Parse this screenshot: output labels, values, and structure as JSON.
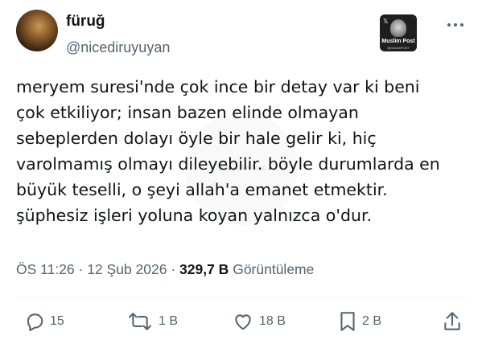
{
  "author": {
    "display_name": "füruğ",
    "handle": "@nicediruyuyan"
  },
  "watermark_badge": {
    "title": "Muslim Post",
    "subtitle": "@MuslimPOST",
    "x_glyph": "𝕏"
  },
  "tweet": {
    "lines": [
      "meryem suresi'nde çok ince bir detay var ki beni",
      "çok etkiliyor; insan bazen elinde olmayan",
      "sebeplerden dolayı öyle bir hale gelir ki, hiç",
      "varolmamış olmayı dileyebilir. böyle durumlarda en",
      "büyük teselli, o şeyi allah'a emanet etmektir.",
      "şüphesiz işleri yoluna koyan yalnızca o'dur."
    ]
  },
  "center_watermark": "@MuslimPost",
  "meta": {
    "time": "ÖS 11:26",
    "separator": " · ",
    "date": "12 Şub 2026",
    "views_count": "329,7 B",
    "views_label": "Görüntüleme"
  },
  "actions": {
    "reply_count": "15",
    "retweet_count": "1 B",
    "like_count": "18 B",
    "bookmark_count": "2 B"
  },
  "colors": {
    "text": "#0f1419",
    "secondary": "#536471",
    "divider": "#eff3f4"
  }
}
